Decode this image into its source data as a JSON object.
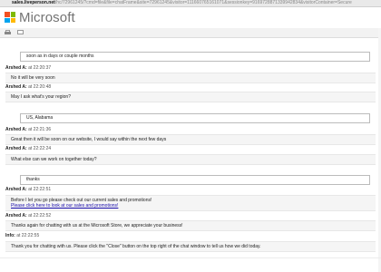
{
  "browser": {
    "url_host": "sales.liveperson.net",
    "url_path": "/hc/72961245/?cmd=file&file=chatFrame&site=72961245&visitor=111660765161071&sessionkey=9169728871339942834&visitorContainer=Secure"
  },
  "brand": {
    "name": "Microsoft",
    "colors": {
      "red": "#f25022",
      "green": "#7fba00",
      "blue": "#00a4ef",
      "yellow": "#ffb900"
    }
  },
  "toolbar": {
    "icons": [
      "print-icon",
      "email-icon"
    ]
  },
  "transcript": [
    {
      "kind": "user",
      "text": "soon as in days or couple months"
    },
    {
      "kind": "header",
      "who": "Arshed A:",
      "when": "at 22:20:37"
    },
    {
      "kind": "msg",
      "text": "No it will be very soon"
    },
    {
      "kind": "header",
      "who": "Arshed A:",
      "when": "at 22:20:48"
    },
    {
      "kind": "msg",
      "text": "May I ask what's your region?"
    },
    {
      "kind": "user",
      "text": "US, Alabama"
    },
    {
      "kind": "header",
      "who": "Arshed A:",
      "when": "at 22:21:36"
    },
    {
      "kind": "msg",
      "text": "Great then it will be soon on our website, I would say within the next few days"
    },
    {
      "kind": "header",
      "who": "Arshed A:",
      "when": "at 22:22:24"
    },
    {
      "kind": "msg",
      "text": "What else can we work on together today?"
    },
    {
      "kind": "user",
      "text": "thanks"
    },
    {
      "kind": "header",
      "who": "Arshed A:",
      "when": "at 22:22:51"
    },
    {
      "kind": "msg2",
      "text": "Before I let you go please check out our current sales and promotions!",
      "link": "Please click here to look at our sales and promotions!"
    },
    {
      "kind": "header",
      "who": "Arshed A:",
      "when": "at 22:22:52"
    },
    {
      "kind": "msg",
      "text": "Thanks again for chatting with us at the Microsoft Store, we appreciate your business!"
    },
    {
      "kind": "header",
      "who": "Info:",
      "when": "at 22:22:55"
    },
    {
      "kind": "msg",
      "text": "Thank you for chatting with us. Please click the \"Close\" button on the top right of the chat window to tell us how we did today."
    }
  ]
}
